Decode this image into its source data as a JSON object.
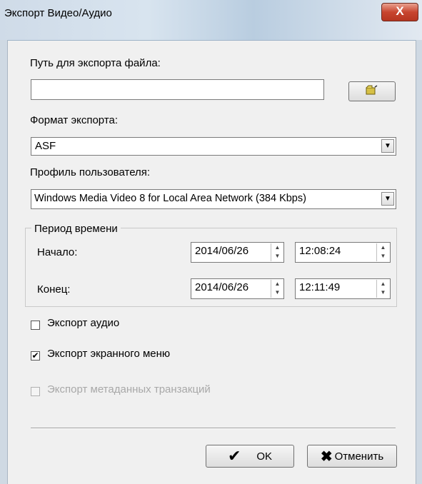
{
  "window": {
    "title": "Экспорт Видео/Аудио",
    "close_label": "X"
  },
  "export_path": {
    "label": "Путь для экспорта файла:",
    "value": "",
    "browse_icon": "folder-open-icon"
  },
  "format": {
    "label": "Формат экспорта:",
    "value": "ASF"
  },
  "profile": {
    "label": "Профиль пользователя:",
    "value": "Windows Media Video 8 for Local Area Network (384 Kbps)"
  },
  "period": {
    "legend": "Период времени",
    "start_label": "Начало:",
    "start_date": "2014/06/26",
    "start_time": "12:08:24",
    "end_label": "Конец:",
    "end_date": "2014/06/26",
    "end_time": "12:11:49"
  },
  "options": {
    "audio": {
      "label": "Экспорт аудио",
      "checked": false
    },
    "osd": {
      "label": "Экспорт экранного меню",
      "checked": true
    },
    "metadata": {
      "label": "Экспорт метаданных транзакций",
      "checked": false,
      "disabled": true
    }
  },
  "buttons": {
    "ok": "OK",
    "cancel": "Отменить"
  },
  "colors": {
    "close_button": "#c8452f",
    "titlebar": "#cfdbe8"
  }
}
